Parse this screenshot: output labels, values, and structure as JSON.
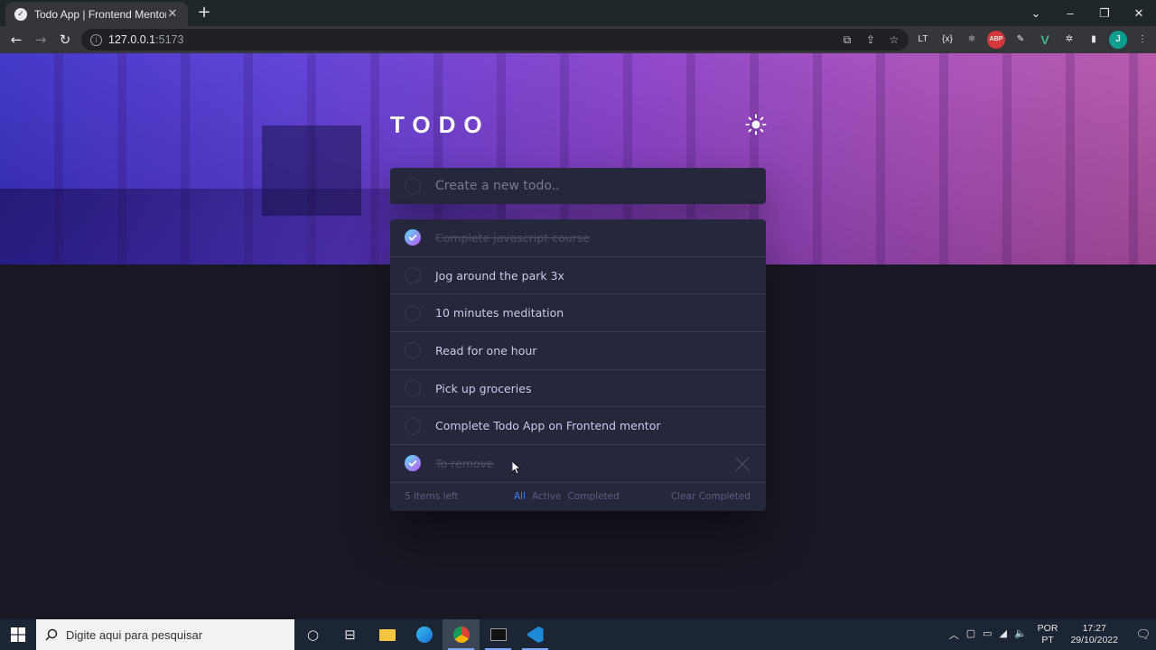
{
  "browser": {
    "tab_title": "Todo App | Frontend Mentor",
    "tab_close": "✕",
    "new_tab": "+",
    "url_host": "127.0.0.1",
    "url_port": ":5173",
    "window_controls": {
      "minimize": "–",
      "maximize": "❐",
      "close": "✕",
      "dropdown": "⌄"
    },
    "extensions": [
      "LT",
      "{x}",
      "⚛",
      "ABP",
      "✎",
      "V",
      "✲",
      "▮",
      "J"
    ]
  },
  "app": {
    "title": "TODO",
    "new_todo_placeholder": "Create a new todo..",
    "todos": [
      {
        "text": "Complete javascript course",
        "completed": true
      },
      {
        "text": "Jog around the park 3x",
        "completed": false
      },
      {
        "text": "10 minutes meditation",
        "completed": false
      },
      {
        "text": "Read for one hour",
        "completed": false
      },
      {
        "text": "Pick up groceries",
        "completed": false
      },
      {
        "text": "Complete Todo App on Frontend mentor",
        "completed": false
      },
      {
        "text": "To remove",
        "completed": true
      }
    ],
    "footer": {
      "items_left": "5 items left",
      "filters": [
        "All",
        "Active",
        "Completed"
      ],
      "active_filter": "All",
      "clear_completed": "Clear Completed"
    },
    "colors": {
      "accent": "#3a7cfd",
      "card": "#25273d",
      "background": "#171823",
      "check_gradient_start": "#55ddff",
      "check_gradient_end": "#c058f3"
    }
  },
  "taskbar": {
    "search_placeholder": "Digite aqui para pesquisar",
    "lang_top": "POR",
    "lang_bottom": "PT",
    "time": "17:27",
    "date": "29/10/2022"
  }
}
